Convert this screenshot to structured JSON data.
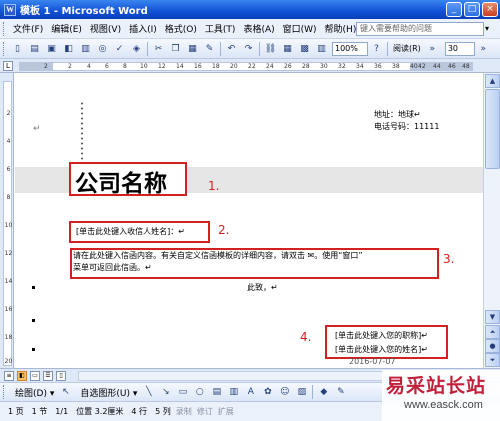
{
  "window": {
    "title": "模板 1 - Microsoft Word",
    "minimize": "_",
    "maximize": "□",
    "close": "×"
  },
  "menu": {
    "items": [
      "文件(F)",
      "编辑(E)",
      "视图(V)",
      "插入(I)",
      "格式(O)",
      "工具(T)",
      "表格(A)",
      "窗口(W)",
      "帮助(H)"
    ],
    "help_placeholder": "键入需要帮助的问题"
  },
  "toolbar": {
    "zoom": "100%",
    "reading_label": "阅读(R)",
    "font_size": "30"
  },
  "ruler": {
    "numbers": [
      "2",
      "2",
      "4",
      "6",
      "8",
      "10",
      "12",
      "14",
      "16",
      "18",
      "20",
      "22",
      "24",
      "26",
      "28",
      "30",
      "32",
      "34",
      "36",
      "38",
      "40",
      "42",
      "44",
      "46",
      "48"
    ]
  },
  "vruler": {
    "numbers": [
      "2",
      "4",
      "6",
      "8",
      "10",
      "12",
      "14",
      "16",
      "18",
      "20"
    ]
  },
  "document": {
    "address_line": "地址：地球↵",
    "phone_line": "电话号码：11111",
    "company_name": "公司名称",
    "recipient_placeholder": "[单击此处键入收信人姓名]：↵",
    "body_line1": "请在此处键入信函内容。有关自定义信函模板的详细内容，请双击 ✉。使用“窗口”",
    "body_line2": "菜单可返回此信函。↵",
    "closing": "此致，↵",
    "sig_title": "[单击此处键入您的职称]↵",
    "sig_name": "[单击此处键入您的姓名]↵",
    "date_partial": "2016-07-07",
    "corner_mark": "↵"
  },
  "annotations": {
    "a1": "1.",
    "a2": "2.",
    "a3": "3.",
    "a4": "4."
  },
  "drawbar": {
    "draw_label": "绘图(D) ▾",
    "autoshape_label": "自选图形(U) ▾"
  },
  "status": {
    "page": "1 页",
    "section": "1 节",
    "page_of": "1/1",
    "position": "位置 3.2厘米",
    "line": "4 行",
    "column": "5 列",
    "rec": "录制",
    "trk": "修订",
    "ext": "扩展"
  },
  "watermark": {
    "text": "易采站长站",
    "url": "www.easck.com"
  },
  "colors": {
    "annotation": "#d32020",
    "titlebar": "#1152d6",
    "watermark": "#c0203a"
  }
}
